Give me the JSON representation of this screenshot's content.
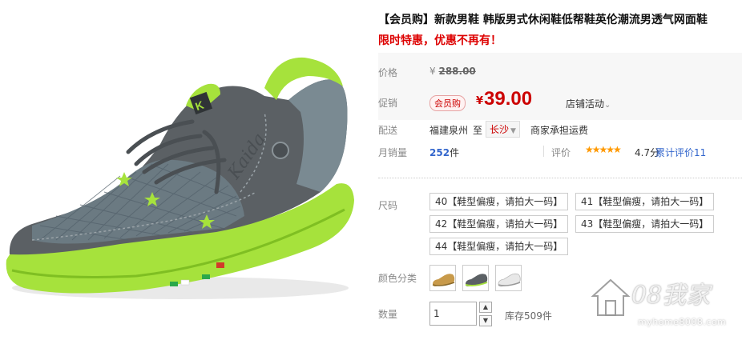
{
  "product": {
    "title": "【会员购】新款男鞋 韩版男式休闲鞋低帮鞋英伦潮流男透气网面鞋",
    "subtitle": "限时特惠，优惠不再有！",
    "shoe_brand_text": "Kaida",
    "shoe_logo_text": "K"
  },
  "price": {
    "label": "价格",
    "currency": "¥",
    "original": "288.00"
  },
  "promo": {
    "label": "促销",
    "badge": "会员购",
    "currency": "¥",
    "price": "39.00",
    "store_activity": "店铺活动",
    "chevron": "⌄"
  },
  "shipping": {
    "label": "配送",
    "from": "福建泉州",
    "to_label": "至",
    "destination": "长沙",
    "fee_note": "商家承担运费"
  },
  "sales": {
    "label": "月销量",
    "count": "252",
    "unit": "件",
    "rating_label": "评价",
    "stars": "★★★★★",
    "score": "4.7分",
    "review_link": "累计评价11"
  },
  "size": {
    "label": "尺码",
    "options": [
      "40【鞋型偏瘦，请拍大一码】",
      "41【鞋型偏瘦，请拍大一码】",
      "42【鞋型偏瘦，请拍大一码】",
      "43【鞋型偏瘦，请拍大一码】",
      "44【鞋型偏瘦，请拍大一码】"
    ]
  },
  "color": {
    "label": "颜色分类",
    "swatches": [
      "tan-shoe",
      "gray-green-shoe",
      "white-shoe"
    ]
  },
  "quantity": {
    "label": "数量",
    "value": "1",
    "up": "▲",
    "down": "▼",
    "stock": "库存509件"
  },
  "watermark": {
    "text": "08我家",
    "url": "myhome8008.com"
  },
  "colors": {
    "accent_red": "#cc0000",
    "link_blue": "#3366cc",
    "shoe_green": "#9ee23a",
    "shoe_gray": "#5a5f63"
  }
}
